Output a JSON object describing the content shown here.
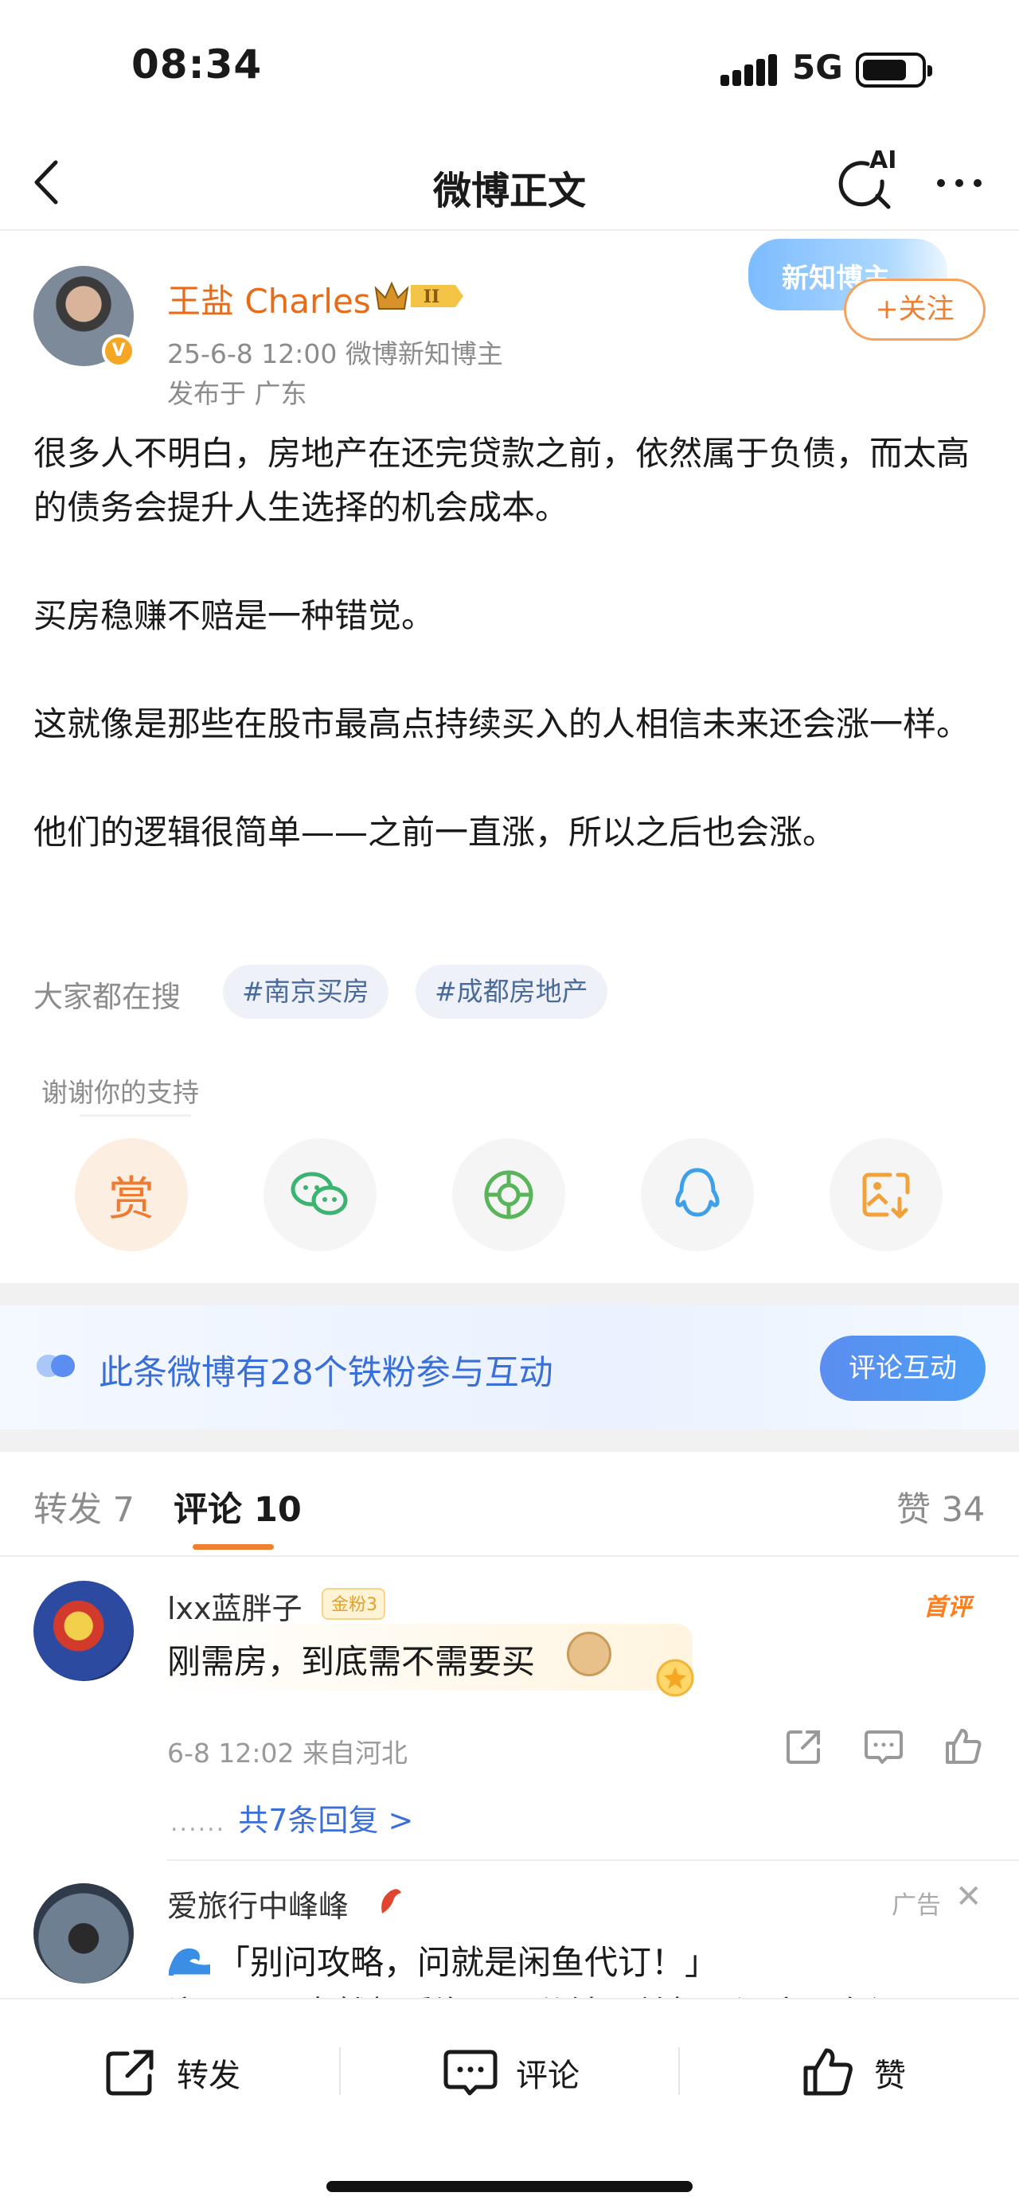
{
  "status_bar": {
    "time": "08:34",
    "network": "5G"
  },
  "nav": {
    "title": "微博正文",
    "ai_label": "AI"
  },
  "post": {
    "author": "王盐 Charles",
    "level_badge": "II",
    "meta": "25-6-8 12:00  微博新知博主",
    "location": "发布于 广东",
    "ribbon": "新知博主",
    "follow_label": "+关注",
    "paragraphs": [
      "很多人不明白，房地产在还完贷款之前，依然属于负债，而太高的债务会提升人生选择的机会成本。",
      "买房稳赚不赔是一种错觉。",
      "这就像是那些在股市最高点持续买入的人相信未来还会涨一样。",
      "他们的逻辑很简单——之前一直涨，所以之后也会涨。"
    ]
  },
  "search": {
    "label": "大家都在搜",
    "tags": [
      "#南京买房",
      "#成都房地产"
    ]
  },
  "support": {
    "label": "谢谢你的支持",
    "reward_label": "赏"
  },
  "share_icons": [
    "reward-icon",
    "wechat-icon",
    "moments-icon",
    "qq-icon",
    "save-image-icon"
  ],
  "fans_banner": {
    "text": "此条微博有28个铁粉参与互动",
    "button": "评论互动"
  },
  "tabs": {
    "repost": "转发 7",
    "comment": "评论 10",
    "like": "赞 34"
  },
  "comment": {
    "user": "lxx蓝胖子",
    "fan_badge": "金粉3",
    "first_label": "首评",
    "text": "刚需房，到底需不需要买",
    "meta": "6-8 12:02  来自河北",
    "replies": "共7条回复 >",
    "replies_dots": "......"
  },
  "ad": {
    "user": "爱旅行中峰峰",
    "label": "广告",
    "close": "✕",
    "text": "「别问攻略，问就是闲鱼代订！」",
    "text2": "溜面……肯然想看海，三分钟下单机票酒店！有问"
  },
  "bottom_bar": {
    "repost": "转发",
    "comment": "评论",
    "like": "赞"
  },
  "colors": {
    "accent_orange": "#f08030",
    "link_blue": "#3b6fd8",
    "gray_text": "#8c8c8c"
  }
}
